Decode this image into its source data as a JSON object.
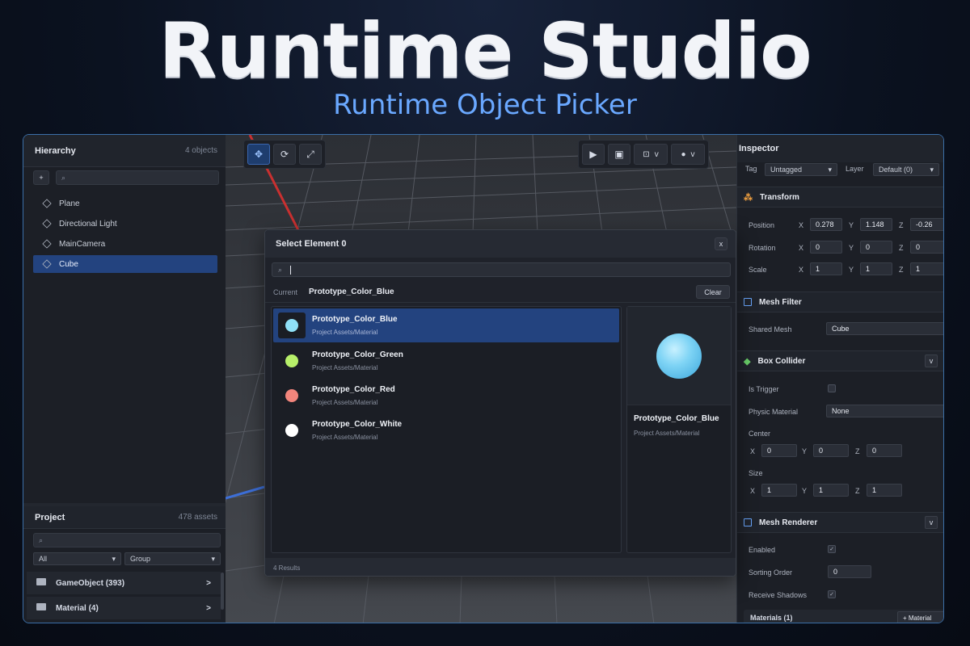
{
  "hero": {
    "title": "Runtime Studio",
    "subtitle": "Runtime Object Picker"
  },
  "hierarchy": {
    "title": "Hierarchy",
    "count": "4 objects",
    "add_label": "+",
    "items": [
      {
        "label": "Plane"
      },
      {
        "label": "Directional Light"
      },
      {
        "label": "MainCamera"
      },
      {
        "label": "Cube"
      }
    ]
  },
  "project": {
    "title": "Project",
    "count": "478 assets",
    "filter": "All",
    "group": "Group",
    "folders": [
      {
        "label": "GameObject (393)",
        "chevron": ">"
      },
      {
        "label": "Material (4)",
        "chevron": ">"
      }
    ]
  },
  "toolbar": {
    "play_menu_chevron": "v",
    "shading_chevron": "v"
  },
  "dialog": {
    "title": "Select Element 0",
    "close_label": "x",
    "current_label": "Current",
    "current_value": "Prototype_Color_Blue",
    "clear_label": "Clear",
    "items": [
      {
        "name": "Prototype_Color_Blue",
        "path": "Project Assets/Material",
        "color": "#8fe0f7"
      },
      {
        "name": "Prototype_Color_Green",
        "path": "Project Assets/Material",
        "color": "#b7f06a"
      },
      {
        "name": "Prototype_Color_Red",
        "path": "Project Assets/Material",
        "color": "#f2857c"
      },
      {
        "name": "Prototype_Color_White",
        "path": "Project Assets/Material",
        "color": "#ffffff"
      }
    ],
    "preview_name": "Prototype_Color_Blue",
    "preview_path": "Project Assets/Material",
    "results": "4 Results"
  },
  "inspector": {
    "title": "Inspector",
    "tag_label": "Tag",
    "tag_value": "Untagged",
    "layer_label": "Layer",
    "layer_value": "Default (0)",
    "transform": {
      "title": "Transform",
      "position_label": "Position",
      "rotation_label": "Rotation",
      "scale_label": "Scale",
      "position": [
        "0.278",
        "1.148",
        "-0.26"
      ],
      "rotation": [
        "0",
        "0",
        "0"
      ],
      "scale": [
        "1",
        "1",
        "1"
      ]
    },
    "mesh_filter": {
      "title": "Mesh Filter",
      "shared_mesh_label": "Shared Mesh",
      "shared_mesh_value": "Cube"
    },
    "box_collider": {
      "title": "Box Collider",
      "is_trigger_label": "Is Trigger",
      "physic_material_label": "Physic Material",
      "physic_material_value": "None",
      "center_label": "Center",
      "center": [
        "0",
        "0",
        "0"
      ],
      "size_label": "Size",
      "size": [
        "1",
        "1",
        "1"
      ]
    },
    "mesh_renderer": {
      "title": "Mesh Renderer",
      "enabled_label": "Enabled",
      "sorting_order_label": "Sorting Order",
      "sorting_order_value": "0",
      "receive_shadows_label": "Receive Shadows",
      "materials_label": "Materials (1)",
      "add_material_label": "+ Material"
    },
    "axes": {
      "x": "X",
      "y": "Y",
      "z": "Z"
    },
    "collapse_label": "v"
  }
}
